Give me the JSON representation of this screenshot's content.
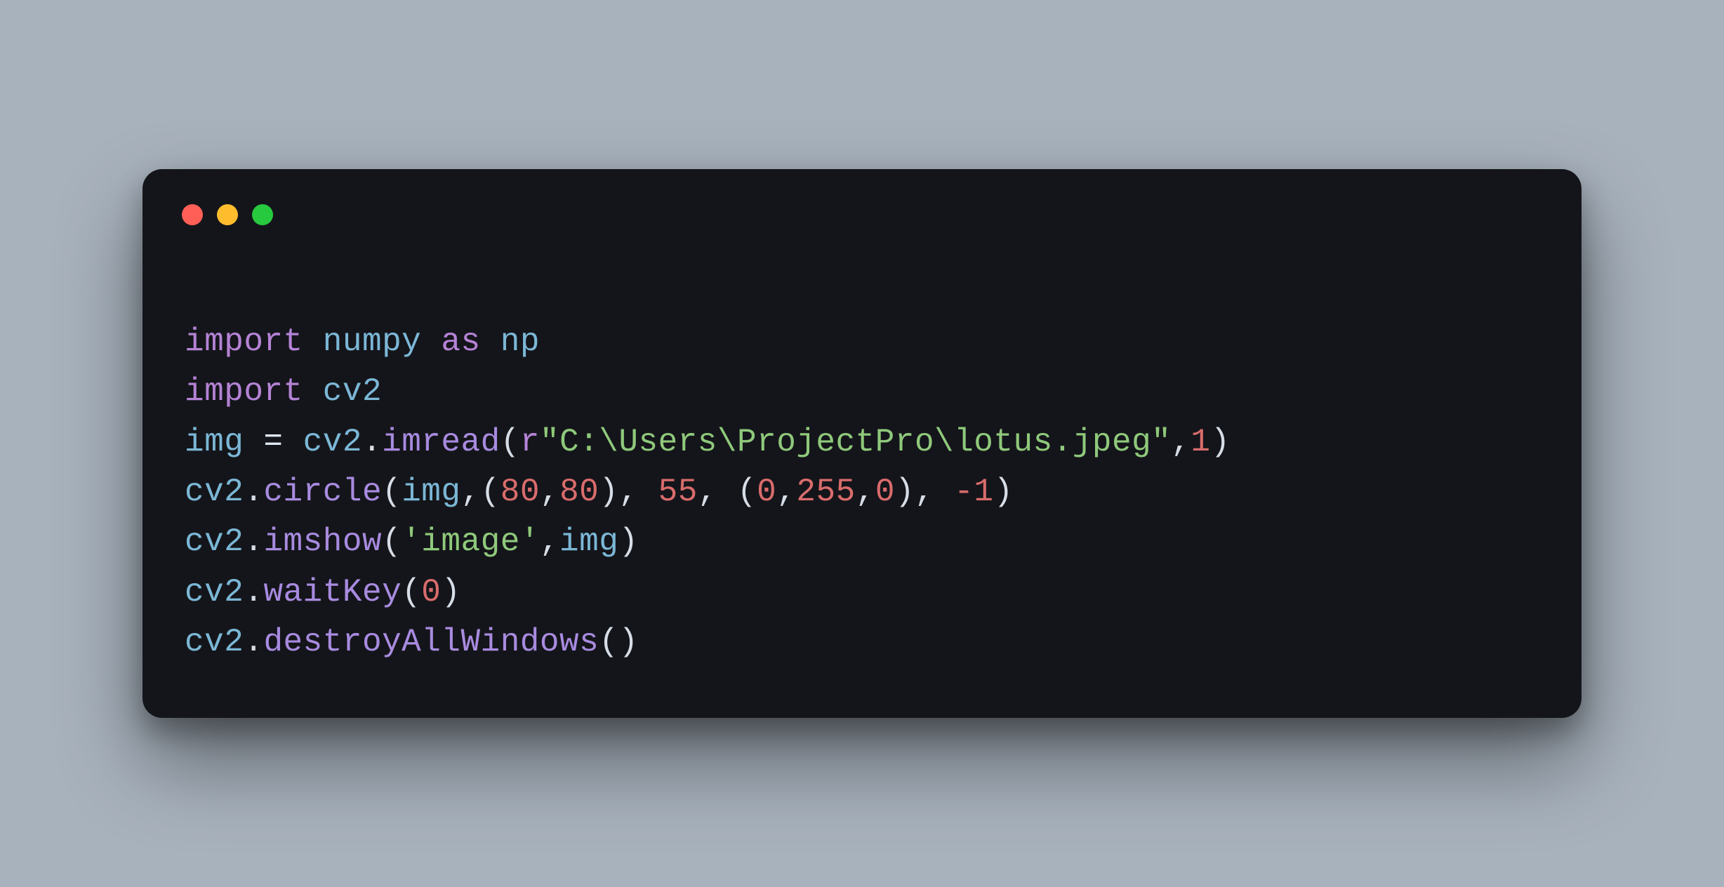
{
  "window": {
    "traffic_lights": [
      "red",
      "yellow",
      "green"
    ]
  },
  "code": {
    "line1": {
      "kw_import": "import",
      "mod": "numpy",
      "kw_as": "as",
      "alias": "np"
    },
    "line2": {
      "kw_import": "import",
      "mod": "cv2"
    },
    "line3": {
      "var": "img",
      "eq": " = ",
      "mod": "cv2",
      "dot": ".",
      "func": "imread",
      "lp": "(",
      "rprefix": "r",
      "str": "\"C:\\Users\\ProjectPro\\lotus.jpeg\"",
      "comma": ",",
      "num1": "1",
      "rp": ")"
    },
    "line4": {
      "mod": "cv2",
      "dot": ".",
      "func": "circle",
      "lp": "(",
      "arg_img": "img",
      "c1": ",(",
      "n80a": "80",
      "c2": ",",
      "n80b": "80",
      "c3": "), ",
      "n55": "55",
      "c4": ", (",
      "n0a": "0",
      "c5": ",",
      "n255": "255",
      "c6": ",",
      "n0b": "0",
      "c7": "), ",
      "neg1": "-1",
      "rp": ")"
    },
    "line5": {
      "mod": "cv2",
      "dot": ".",
      "func": "imshow",
      "lp": "(",
      "str": "'image'",
      "comma": ",",
      "arg_img": "img",
      "rp": ")"
    },
    "line6": {
      "mod": "cv2",
      "dot": ".",
      "func": "waitKey",
      "lp": "(",
      "n0": "0",
      "rp": ")"
    },
    "line7": {
      "mod": "cv2",
      "dot": ".",
      "func": "destroyAllWindows",
      "lp": "(",
      "rp": ")"
    }
  }
}
